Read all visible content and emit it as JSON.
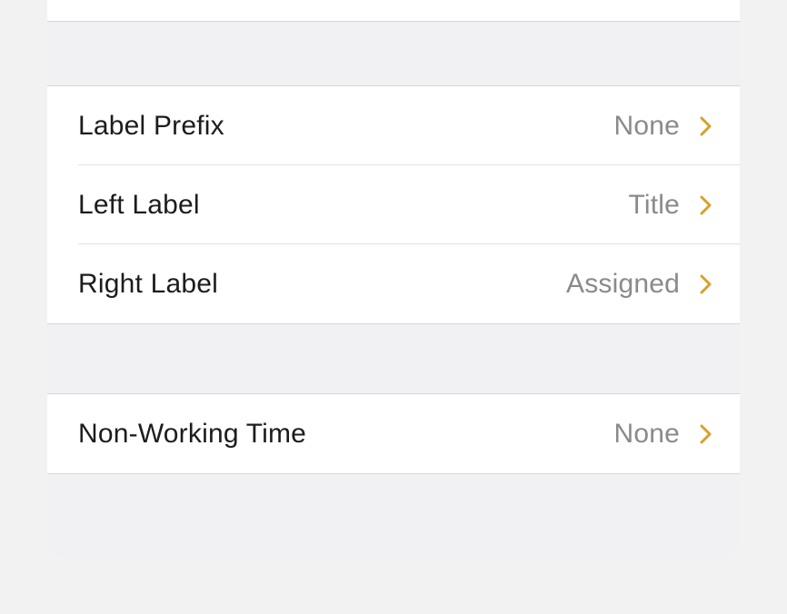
{
  "labels_section": {
    "rows": [
      {
        "label": "Label Prefix",
        "value": "None"
      },
      {
        "label": "Left Label",
        "value": "Title"
      },
      {
        "label": "Right Label",
        "value": "Assigned"
      }
    ]
  },
  "time_section": {
    "rows": [
      {
        "label": "Non-Working Time",
        "value": "None"
      }
    ]
  }
}
